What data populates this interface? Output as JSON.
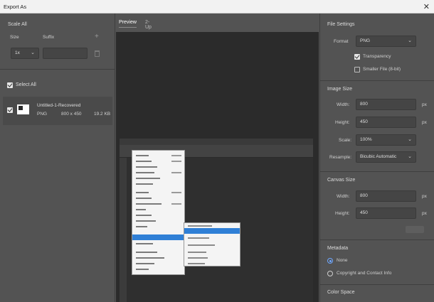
{
  "window": {
    "title": "Export As",
    "close_glyph": "✕"
  },
  "left_panel": {
    "scale_all": {
      "title": "Scale All",
      "size_label": "Size",
      "suffix_label": "Suffix",
      "size_value": "1x",
      "suffix_value": "",
      "add_icon": "plus-icon",
      "delete_icon": "trash-icon"
    },
    "select_all_label": "Select All",
    "assets": [
      {
        "name": "Untitled-1-Recovered",
        "format": "PNG",
        "dimensions": "800 x 450",
        "size": "19.2 KB",
        "checked": true
      }
    ]
  },
  "center": {
    "tabs": [
      {
        "label": "Preview",
        "active": true
      },
      {
        "label": "2-Up",
        "active": false
      }
    ]
  },
  "right_panel": {
    "file_settings": {
      "title": "File Settings",
      "format_label": "Format",
      "format_value": "PNG",
      "transparency_label": "Transparency",
      "transparency_checked": true,
      "smaller_file_label": "Smaller File (8-bit)",
      "smaller_file_checked": false
    },
    "image_size": {
      "title": "Image Size",
      "width_label": "Width:",
      "width_value": "800",
      "height_label": "Height:",
      "height_value": "450",
      "scale_label": "Scale:",
      "scale_value": "100%",
      "resample_label": "Resample:",
      "resample_value": "Bicubic Automatic",
      "unit": "px"
    },
    "canvas_size": {
      "title": "Canvas Size",
      "width_label": "Width:",
      "width_value": "800",
      "height_label": "Height:",
      "height_value": "450",
      "unit": "px"
    },
    "metadata": {
      "title": "Metadata",
      "options": [
        {
          "label": "None",
          "selected": true
        },
        {
          "label": "Copyright and Contact Info",
          "selected": false
        }
      ]
    },
    "color_space": {
      "title": "Color Space"
    }
  },
  "colors": {
    "panel_bg": "#535353",
    "input_bg": "#454545",
    "preview_bg": "#2b2b2b",
    "accent_blue": "#2f7fd6",
    "titlebar_bg": "#f2f2f2"
  }
}
